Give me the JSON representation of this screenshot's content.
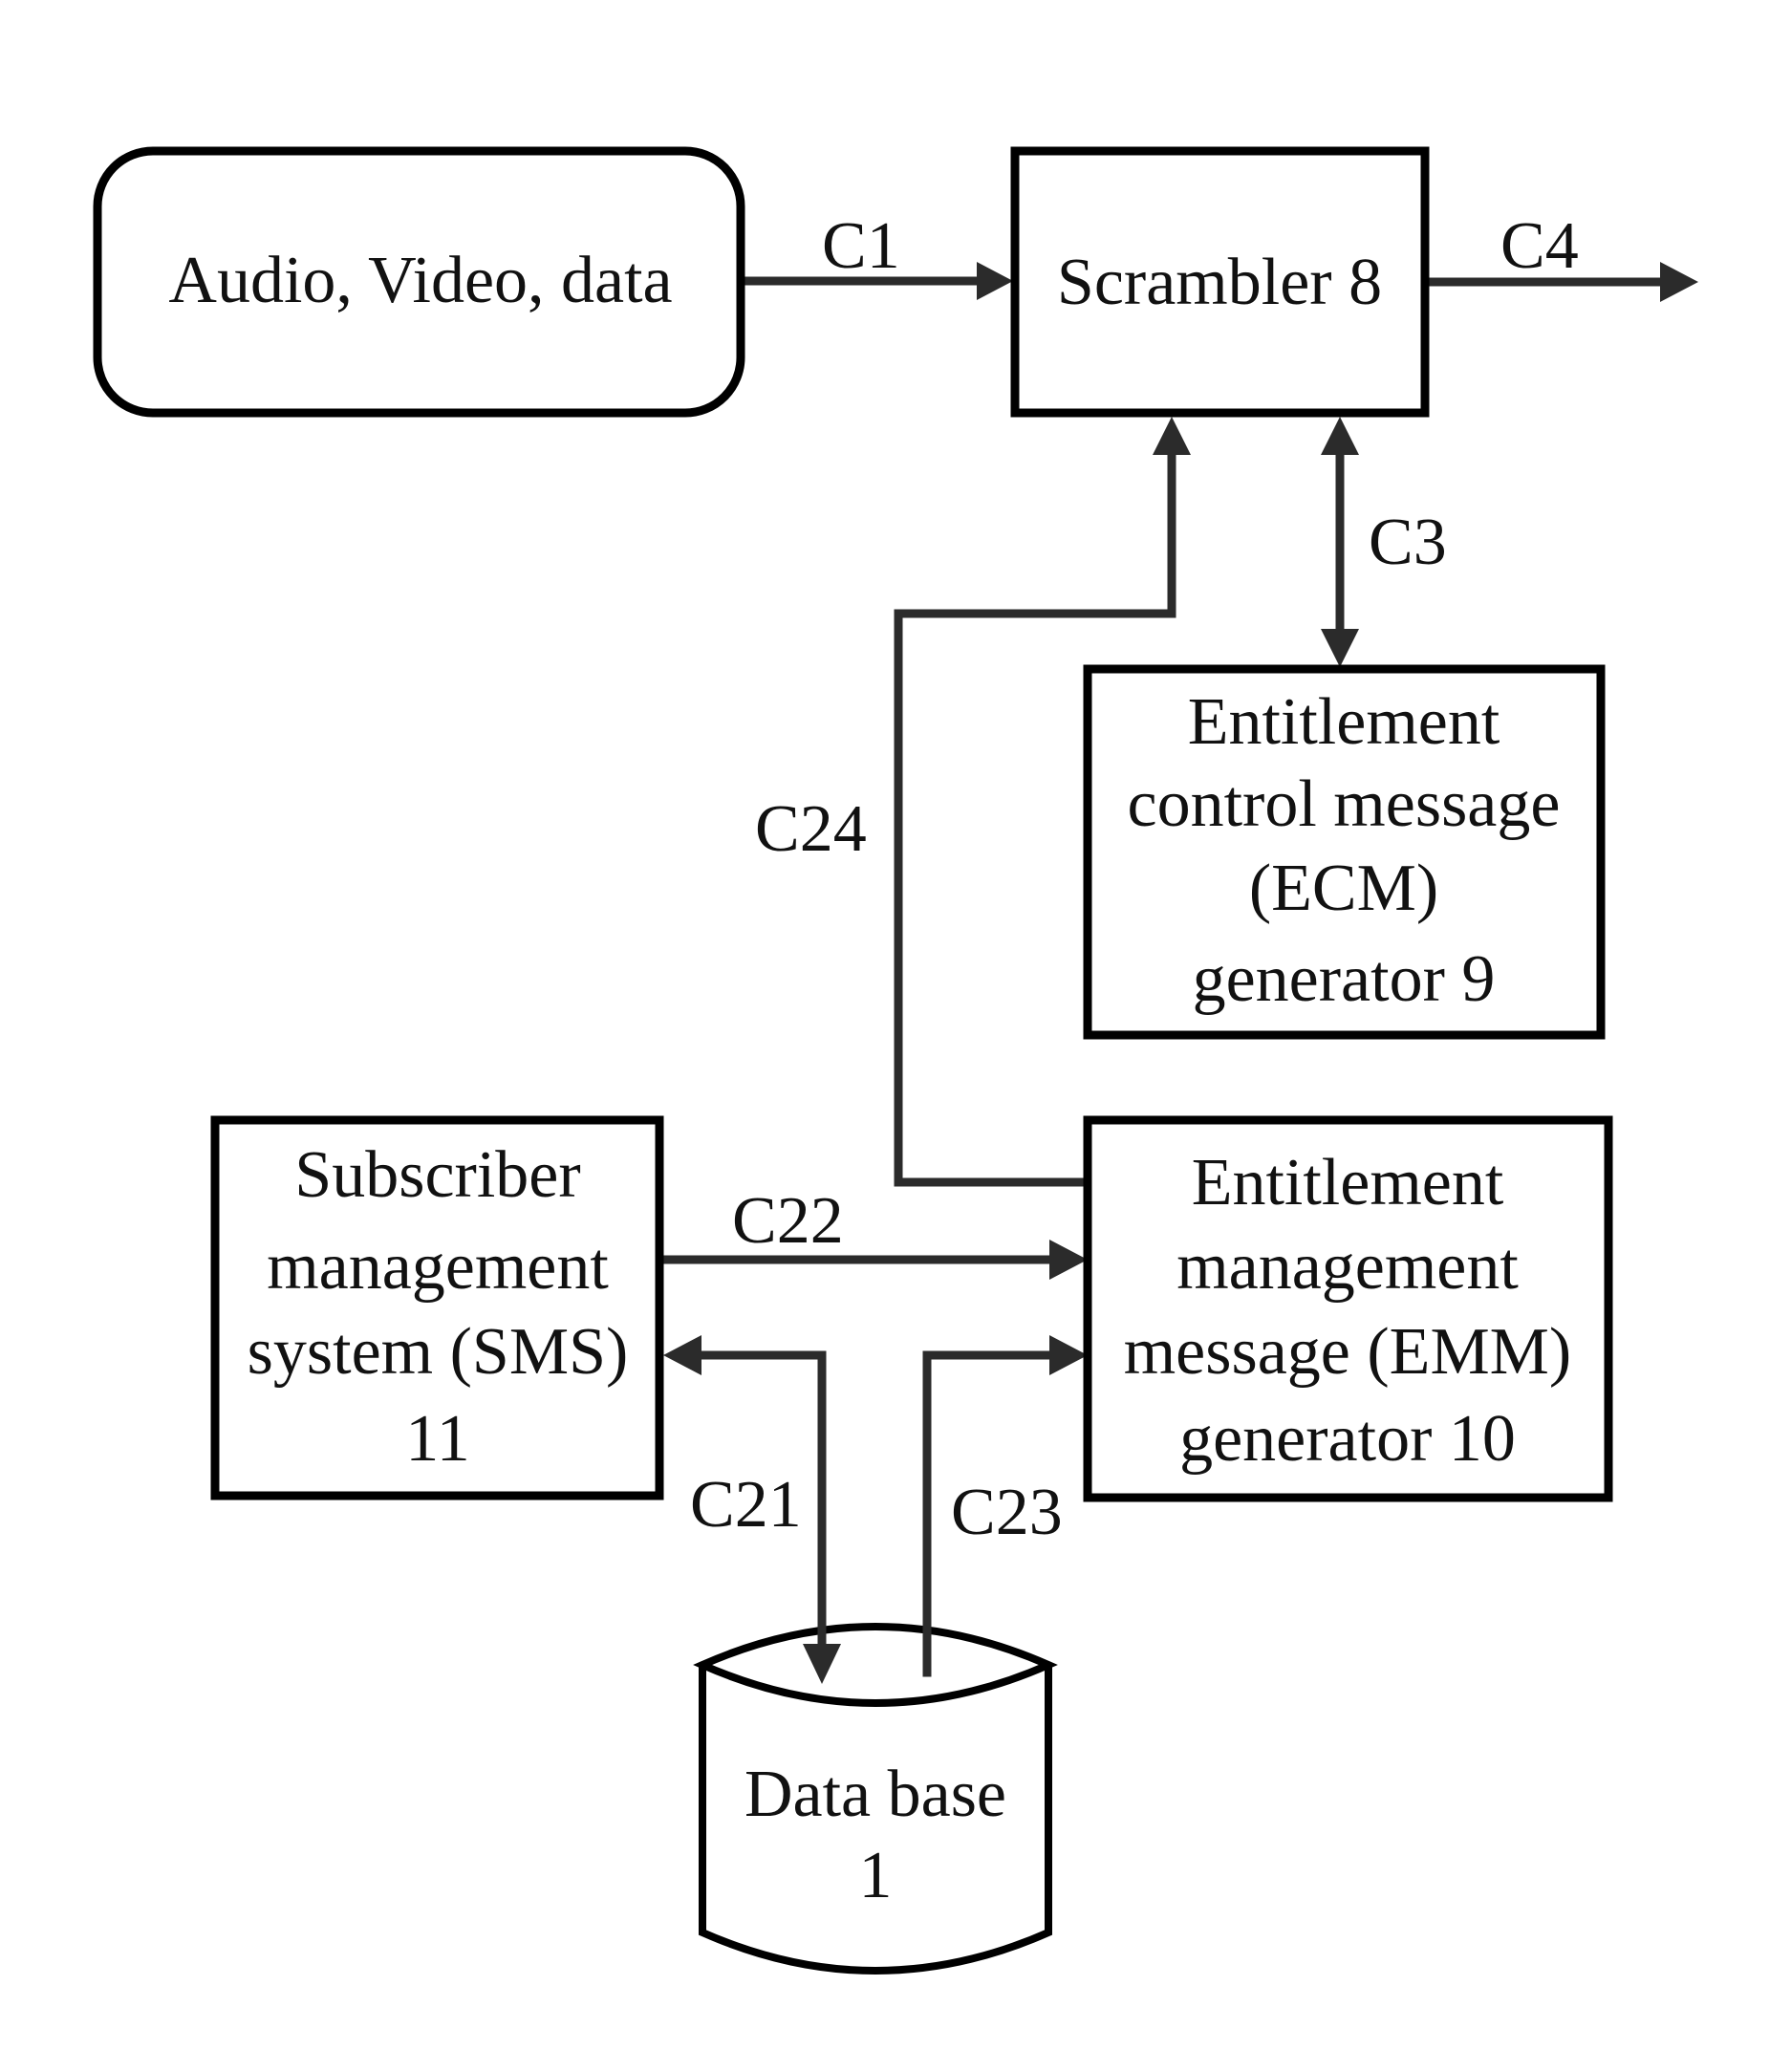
{
  "diagram": {
    "nodes": {
      "source": {
        "lines": [
          "Audio, Video, data"
        ]
      },
      "scrambler": {
        "lines": [
          "Scrambler 8"
        ]
      },
      "ecm": {
        "lines": [
          "Entitlement",
          "control message",
          "(ECM)",
          "generator  9"
        ]
      },
      "emm": {
        "lines": [
          "Entitlement",
          "management",
          "message (EMM)",
          "generator 10"
        ]
      },
      "sms": {
        "lines": [
          "Subscriber",
          "management",
          "system (SMS)",
          "11"
        ]
      },
      "database": {
        "lines": [
          "Data base",
          "1"
        ]
      }
    },
    "connections": {
      "c1": {
        "label": "C1",
        "from": "Audio, Video, data",
        "to": "Scrambler 8",
        "direction": "one-way"
      },
      "c4": {
        "label": "C4",
        "from": "Scrambler 8",
        "to": "output",
        "direction": "one-way"
      },
      "c3": {
        "label": "C3",
        "from": "Scrambler 8",
        "to": "ECM generator 9",
        "direction": "two-way"
      },
      "c24": {
        "label": "C24",
        "from": "EMM generator 10",
        "to": "Scrambler 8",
        "direction": "one-way"
      },
      "c22": {
        "label": "C22",
        "from": "SMS 11",
        "to": "EMM generator 10",
        "direction": "one-way"
      },
      "c21": {
        "label": "C21",
        "from": "SMS 11",
        "to": "Data base 1",
        "direction": "two-way"
      },
      "c23": {
        "label": "C23",
        "from": "Data base 1",
        "to": "EMM generator 10",
        "direction": "one-way"
      }
    }
  },
  "colors": {
    "box_stroke": "#000000",
    "connector": "#2b2b2b",
    "background": "#ffffff"
  }
}
